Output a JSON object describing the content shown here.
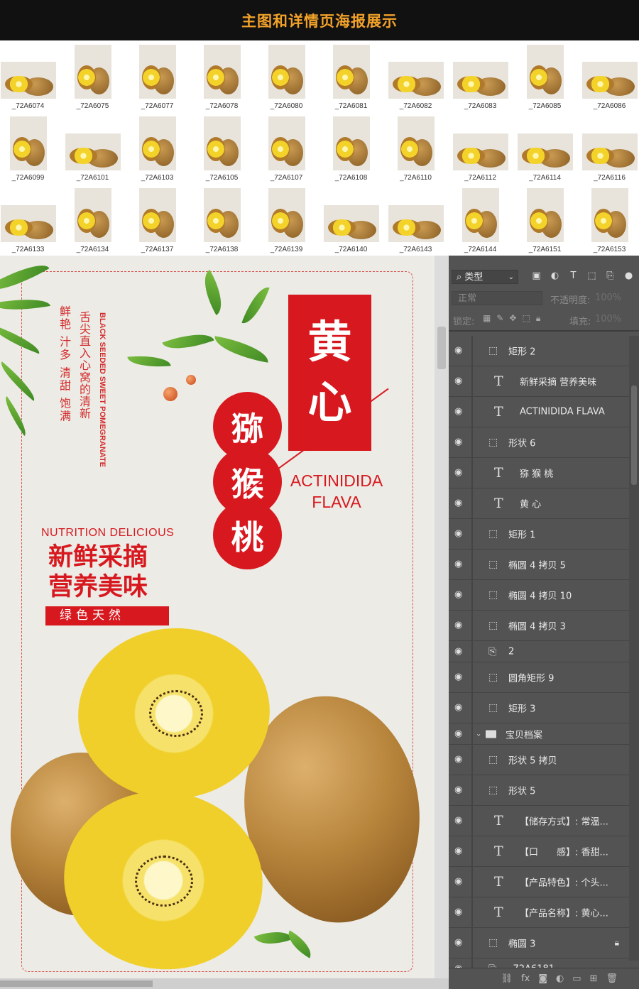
{
  "header": {
    "title": "主图和详情页海报展示"
  },
  "thumbnails": [
    "_72A6074",
    "_72A6075",
    "_72A6077",
    "_72A6078",
    "_72A6080",
    "_72A6081",
    "_72A6082",
    "_72A6083",
    "_72A6085",
    "_72A6086",
    "_72A6099",
    "_72A6101",
    "_72A6103",
    "_72A6105",
    "_72A6107",
    "_72A6108",
    "_72A6110",
    "_72A6112",
    "_72A6114",
    "_72A6116",
    "_72A6133",
    "_72A6134",
    "_72A6137",
    "_72A6138",
    "_72A6139",
    "_72A6140",
    "_72A6143",
    "_72A6144",
    "_72A6151",
    "_72A6153"
  ],
  "poster": {
    "vertical_left": "鲜艳 汁多 清甜 饱满",
    "vertical_mid": "舌尖直入心窝的清新",
    "vertical_en": "BLACK SEEDED SWEET POMEGRANATE",
    "box_chars": [
      "黄",
      "心"
    ],
    "circle_chars": [
      "猕",
      "猴",
      "桃"
    ],
    "latin_line1": "ACTINIDIDA",
    "latin_line2": "FLAVA",
    "nutrition": "NUTRITION DELICIOUS",
    "slogan_line1": "新鲜采摘",
    "slogan_line2": "营养美味",
    "tag": "绿色天然"
  },
  "panel": {
    "kind_filter": "类型",
    "blend_mode": "正常",
    "opacity_label": "不透明度:",
    "opacity_value": "100%",
    "lock_label": "锁定:",
    "fill_label": "填充:",
    "fill_value": "100%",
    "layers": [
      {
        "type": "shape",
        "name": "矩形 2"
      },
      {
        "type": "text",
        "name": "新鲜采摘 营养美味"
      },
      {
        "type": "text",
        "name": "ACTINIDIDA FLAVA"
      },
      {
        "type": "shape",
        "name": "形状 6"
      },
      {
        "type": "text",
        "name": "猕 猴 桃"
      },
      {
        "type": "text",
        "name": "黄 心"
      },
      {
        "type": "shape",
        "name": "矩形 1"
      },
      {
        "type": "shape",
        "name": "椭圆 4 拷贝 5"
      },
      {
        "type": "shape",
        "name": "椭圆 4 拷贝 10"
      },
      {
        "type": "shape",
        "name": "椭圆 4 拷贝 3"
      },
      {
        "type": "smart",
        "name": "2"
      },
      {
        "type": "shape",
        "name": "圆角矩形 9"
      },
      {
        "type": "shape",
        "name": "矩形 3"
      },
      {
        "type": "group",
        "name": "宝贝档案"
      },
      {
        "type": "shape",
        "name": "形状 5 拷贝"
      },
      {
        "type": "shape",
        "name": "形状 5"
      },
      {
        "type": "text",
        "name": "【储存方式】: 常温..."
      },
      {
        "type": "text",
        "name": "【口　　感】: 香甜..."
      },
      {
        "type": "text",
        "name": "【产品特色】: 个头..."
      },
      {
        "type": "text",
        "name": "【产品名称】: 黄心..."
      },
      {
        "type": "shape",
        "name": "椭圆 3"
      },
      {
        "type": "smart",
        "name": "_72A6181"
      }
    ]
  }
}
